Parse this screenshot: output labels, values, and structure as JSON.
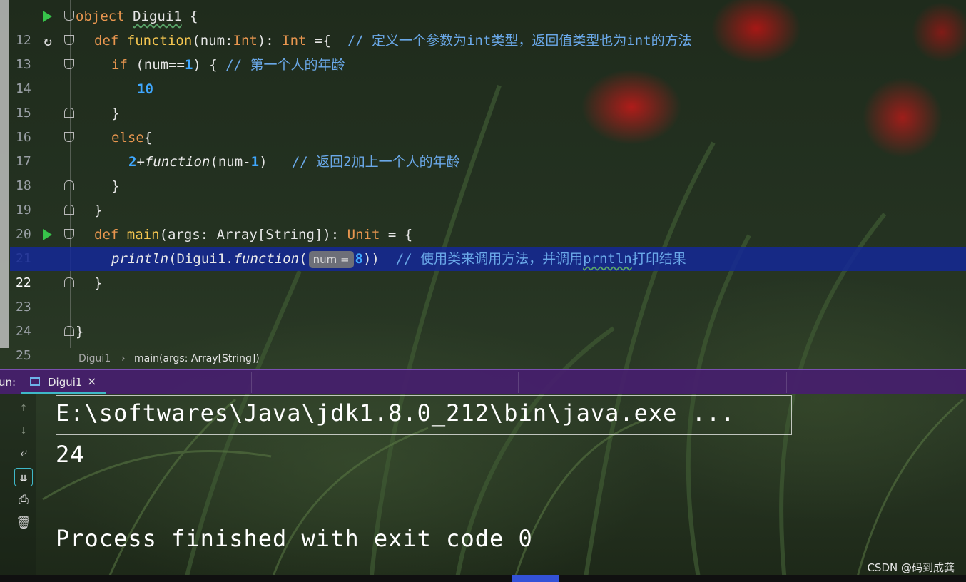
{
  "editor": {
    "lines": [
      {
        "n": "12"
      },
      {
        "n": "13"
      },
      {
        "n": "14"
      },
      {
        "n": "15"
      },
      {
        "n": "16"
      },
      {
        "n": "17"
      },
      {
        "n": "18"
      },
      {
        "n": "19"
      },
      {
        "n": "20"
      },
      {
        "n": "21"
      },
      {
        "n": "22"
      },
      {
        "n": "23"
      },
      {
        "n": "24"
      },
      {
        "n": "25"
      }
    ],
    "code": {
      "l12_kw": "object",
      "l12_name": "Digui1",
      "l12_rest": " {",
      "l13_kw": "def",
      "l13_fn": "function",
      "l13_a": "(num:",
      "l13_t1": "Int",
      "l13_b": "): ",
      "l13_t2": "Int",
      "l13_c": " ={  ",
      "l13_cmt": "// 定义一个参数为int类型，返回值类型也为int的方法",
      "l14_kw": "if",
      "l14_a": " (num==",
      "l14_n": "1",
      "l14_b": ") { ",
      "l14_cmt": "// 第一个人的年龄",
      "l15_n": "10",
      "l16": "}",
      "l17_kw": "else",
      "l17_b": "{",
      "l18_n": "2",
      "l18_a": "+",
      "l18_fn": "function",
      "l18_b": "(num-",
      "l18_n2": "1",
      "l18_c": ")   ",
      "l18_cmt": "// 返回2加上一个人的年龄",
      "l19": "}",
      "l20": "}",
      "l21_kw": "def",
      "l21_fn": "main",
      "l21_a": "(args: Array[String]): ",
      "l21_t": "Unit",
      "l21_b": " = {",
      "l22_fn": "println",
      "l22_a": "(Digui1.",
      "l22_fn2": "function",
      "l22_b": "(",
      "l22_hint": "num =",
      "l22_n": "8",
      "l22_c": "))  ",
      "l22_cmt1": "// 使用类来调用方法，并调用",
      "l22_cmt2": "prntln",
      "l22_cmt3": "打印结果",
      "l23": "}",
      "l25": "}"
    }
  },
  "breadcrumb": {
    "item1": "Digui1",
    "sep": "›",
    "item2": "main(args: Array[String])"
  },
  "run": {
    "label": "un:",
    "tab_name": "Digui1",
    "tab_close": "×"
  },
  "console": {
    "command": "E:\\softwares\\Java\\jdk1.8.0_212\\bin\\java.exe ...",
    "output": "24",
    "finish": "Process finished with exit code 0",
    "tools": {
      "up": "↑",
      "down": "↓",
      "wrap": "⤶",
      "scroll_end": "⇊",
      "print": "⎙",
      "trash": "🗑"
    }
  },
  "watermark": "CSDN @码到成龚",
  "colors": {
    "current_line": "#14289a",
    "keyword": "#e8964f",
    "function": "#f4c550",
    "number": "#3fa8ff",
    "comment": "#6aa8e8",
    "run_arrow": "#37c24a",
    "tab_underline": "#3fb8c8"
  }
}
